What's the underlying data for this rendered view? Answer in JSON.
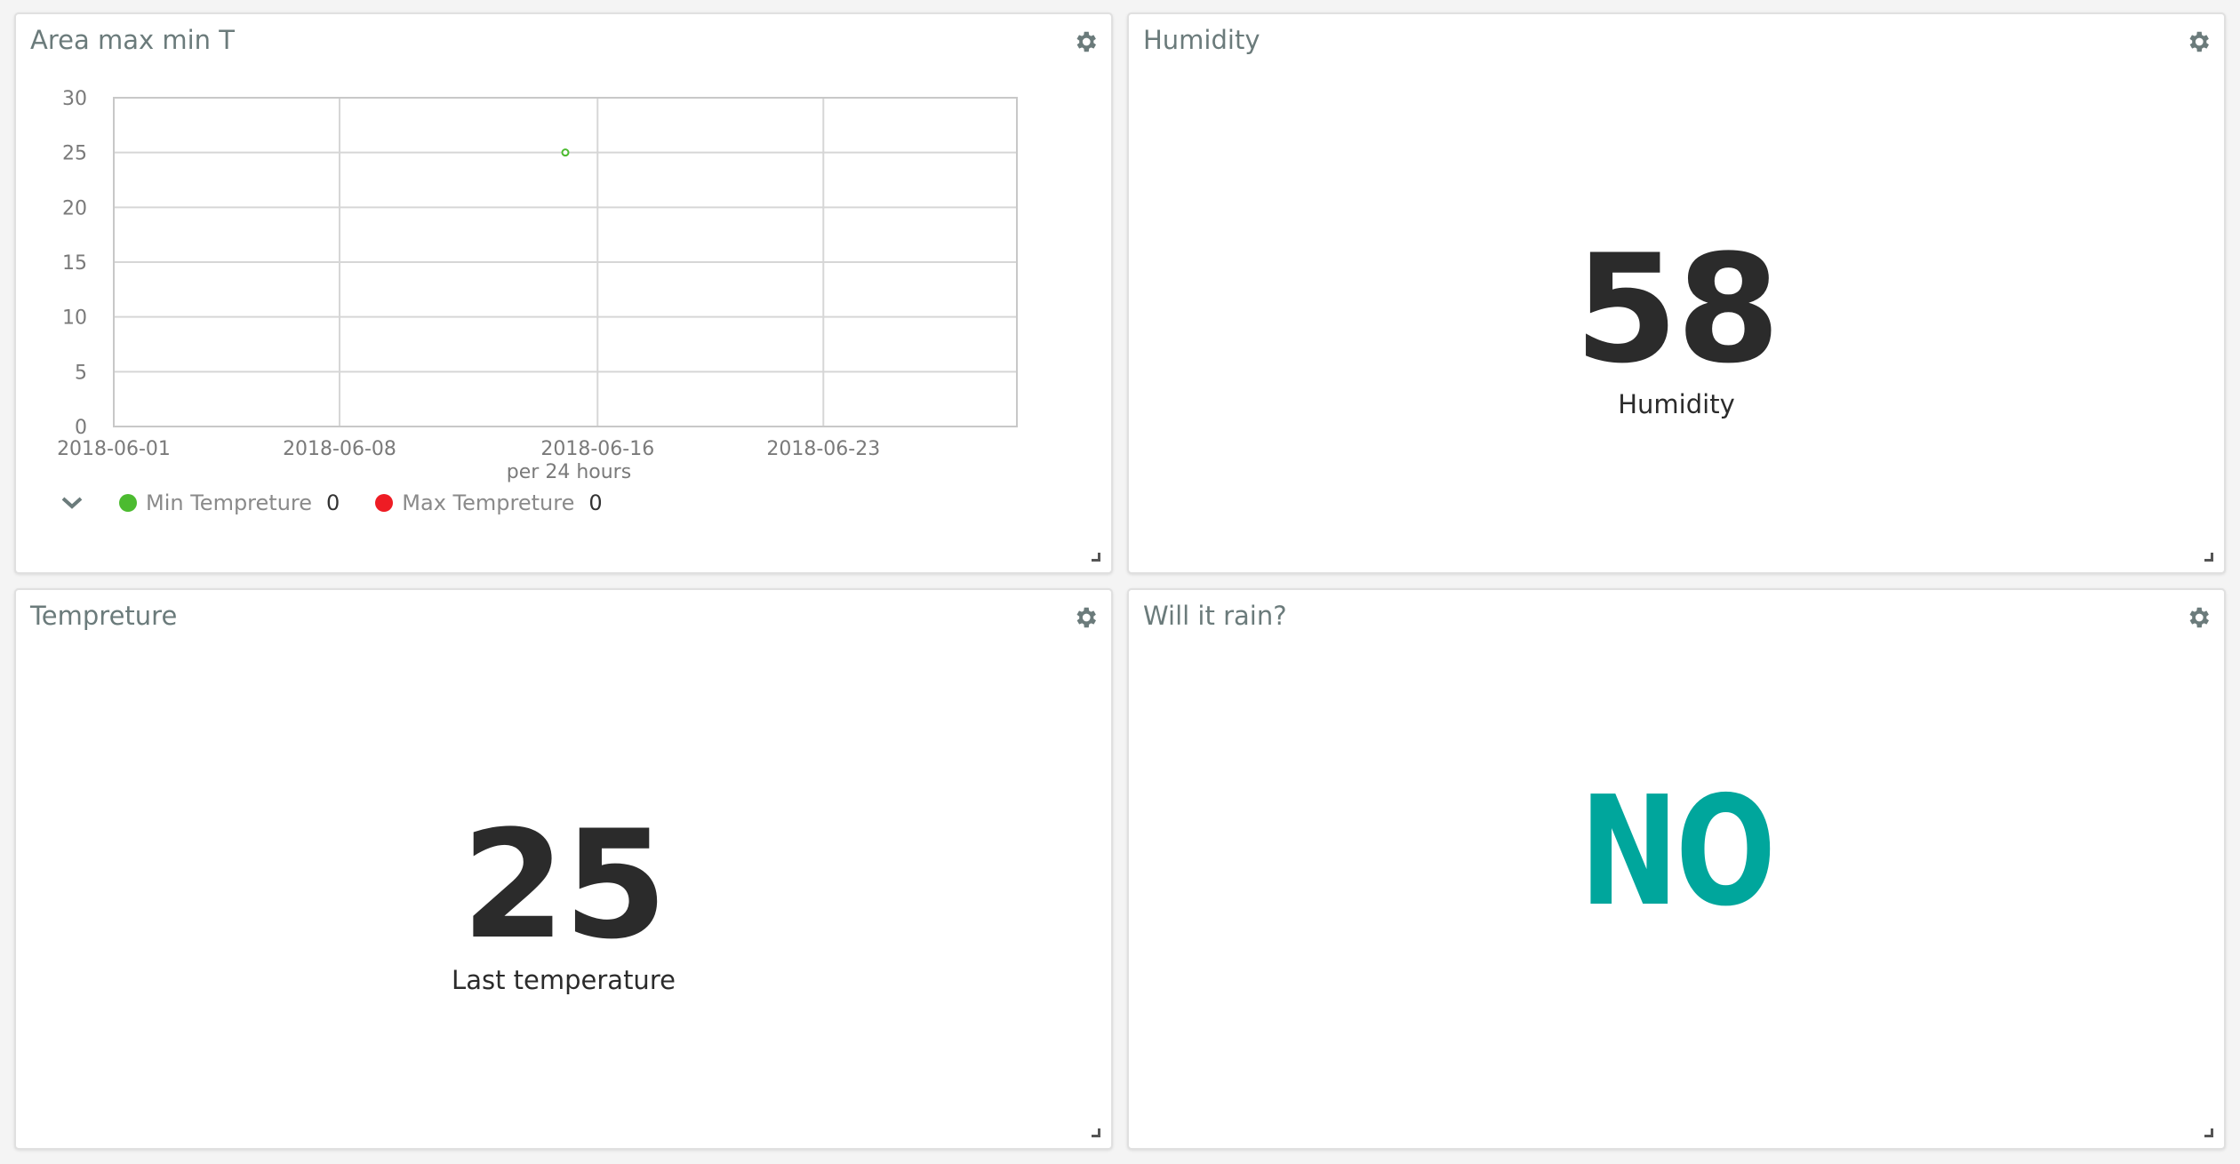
{
  "widgets": {
    "chart": {
      "title": "Area max min T"
    },
    "humidity": {
      "title": "Humidity",
      "value": "58",
      "label": "Humidity"
    },
    "temperature": {
      "title": "Tempreture",
      "value": "25",
      "label": "Last temperature"
    },
    "rain": {
      "title": "Will it rain?",
      "value": "NO",
      "color": "#00a69c"
    }
  },
  "icons": {
    "settings": "gear-icon",
    "resize": "resize-handle-icon",
    "legend_toggle": "chevron-down-icon"
  },
  "chart_data": {
    "type": "area",
    "title": "",
    "xlabel": "per 24 hours",
    "ylabel": "",
    "x_ticks": [
      "2018-06-01",
      "2018-06-08",
      "2018-06-16",
      "2018-06-23"
    ],
    "xlim": [
      "2018-06-01",
      "2018-06-29"
    ],
    "y_ticks": [
      "0",
      "5",
      "10",
      "15",
      "20",
      "25",
      "30"
    ],
    "ylim": [
      0,
      30
    ],
    "grid": true,
    "legend_position": "bottom-left",
    "series": [
      {
        "name": "Min Tempreture",
        "legend_value": "0",
        "color": "#4cbb30",
        "points": [
          {
            "x": "2018-06-15",
            "y": 25
          }
        ]
      },
      {
        "name": "Max Tempreture",
        "legend_value": "0",
        "color": "#ee1c24",
        "points": []
      }
    ]
  }
}
